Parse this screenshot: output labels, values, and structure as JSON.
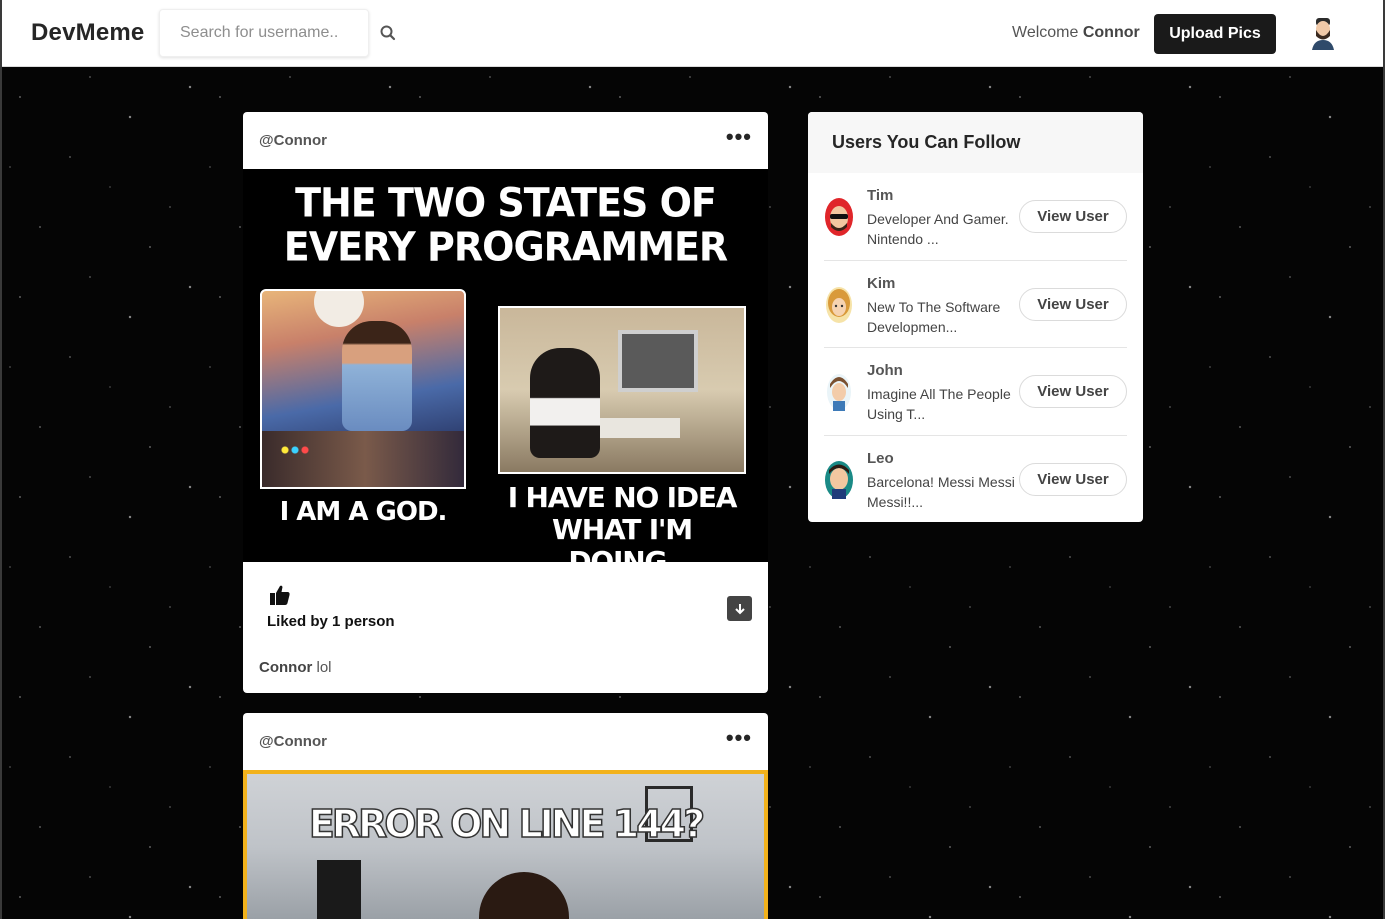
{
  "header": {
    "logo": "DevMeme",
    "search_placeholder": "Search for username..",
    "welcome_prefix": "Welcome",
    "welcome_user": "Connor",
    "upload_label": "Upload Pics"
  },
  "posts": [
    {
      "user": "@Connor",
      "more": "•••",
      "meme_title": "THE TWO STATES OF EVERY PROGRAMMER",
      "caption_left": "I AM A GOD.",
      "caption_right": "I HAVE NO IDEA WHAT I'M DOING.",
      "likes": "Liked by 1 person",
      "comment_user": "Connor",
      "comment_text": "lol"
    },
    {
      "user": "@Connor",
      "more": "•••",
      "meme_title": "ERROR ON LINE 144?"
    }
  ],
  "sidebar": {
    "title": "Users You Can Follow",
    "button_label": "View User",
    "users": [
      {
        "name": "Tim",
        "bio": "Developer And Gamer. Nintendo ..."
      },
      {
        "name": "Kim",
        "bio": "New To The Software Developmen..."
      },
      {
        "name": "John",
        "bio": "Imagine All The People Using T..."
      },
      {
        "name": "Leo",
        "bio": "Barcelona! Messi Messi Messi!!..."
      }
    ]
  },
  "colors": {
    "accent_button": "#1a1a1a",
    "meme2_border": "#f2b21c"
  }
}
